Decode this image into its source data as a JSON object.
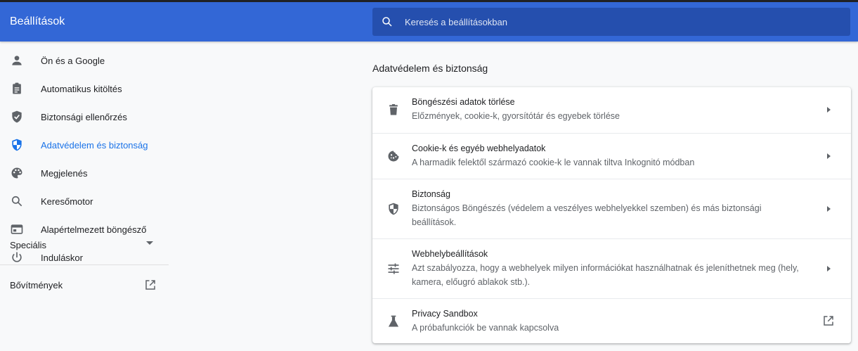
{
  "header": {
    "title": "Beállítások",
    "search_placeholder": "Keresés a beállításokban"
  },
  "sidebar": {
    "items": [
      {
        "label": "Ön és a Google",
        "icon": "person-icon"
      },
      {
        "label": "Automatikus kitöltés",
        "icon": "clipboard-icon"
      },
      {
        "label": "Biztonsági ellenőrzés",
        "icon": "shield-check-icon"
      },
      {
        "label": "Adatvédelem és biztonság",
        "icon": "shield-half-icon",
        "active": true
      },
      {
        "label": "Megjelenés",
        "icon": "palette-icon"
      },
      {
        "label": "Keresőmotor",
        "icon": "search-icon"
      },
      {
        "label": "Alapértelmezett böngésző",
        "icon": "browser-icon"
      },
      {
        "label": "Induláskor",
        "icon": "power-icon"
      }
    ],
    "special_label": "Speciális",
    "extensions_label": "Bővítmények"
  },
  "main": {
    "section_title": "Adatvédelem és biztonság",
    "rows": [
      {
        "title": "Böngészési adatok törlése",
        "sub": "Előzmények, cookie-k, gyorsítótár és egyebek törlése",
        "icon": "trash-icon"
      },
      {
        "title": "Cookie-k és egyéb webhelyadatok",
        "sub": "A harmadik felektől származó cookie-k le vannak tiltva Inkognitó módban",
        "icon": "cookie-icon"
      },
      {
        "title": "Biztonság",
        "sub": "Biztonságos Böngészés (védelem a veszélyes webhelyekkel szemben) és más biztonsági beállítások.",
        "icon": "shield-icon"
      },
      {
        "title": "Webhelybeállítások",
        "sub": "Azt szabályozza, hogy a webhelyek milyen információkat használhatnak és jeleníthetnek meg (hely, kamera, előugró ablakok stb.).",
        "icon": "tune-icon"
      },
      {
        "title": "Privacy Sandbox",
        "sub": "A próbafunkciók be vannak kapcsolva",
        "icon": "flask-icon"
      }
    ]
  },
  "colors": {
    "header_bg": "#3367d6",
    "search_bg": "#254fae",
    "active": "#1a73e8",
    "icon": "#5f6368"
  }
}
